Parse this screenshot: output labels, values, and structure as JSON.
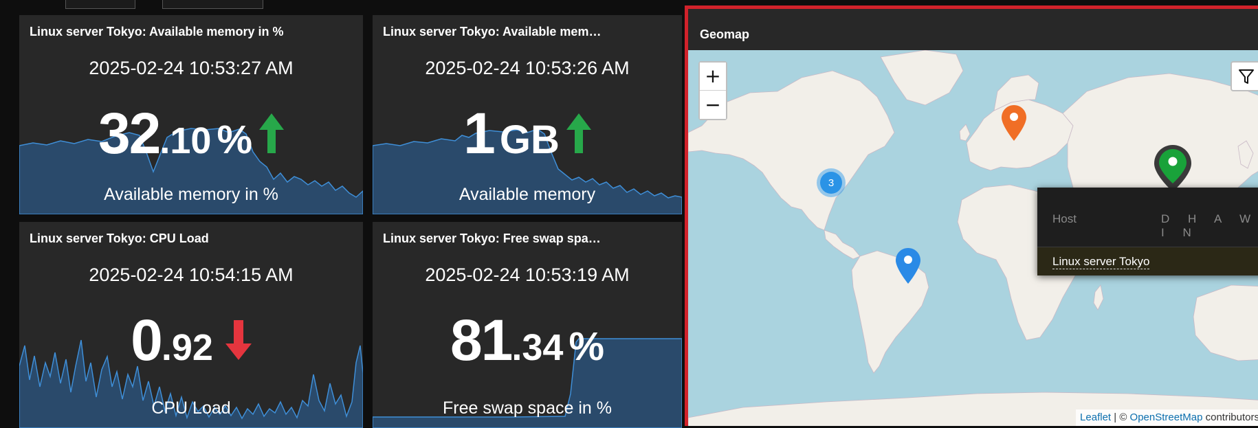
{
  "widgets": [
    {
      "title": "Linux server Tokyo: Available memory in %",
      "timestamp": "2025-02-24 10:53:27 AM",
      "value_int": "32",
      "value_dec": ".10",
      "unit": "%",
      "trend": "up",
      "description": "Available memory in %"
    },
    {
      "title": "Linux server Tokyo: Available mem…",
      "timestamp": "2025-02-24 10:53:26 AM",
      "value_int": "1",
      "value_dec": "",
      "unit": "GB",
      "trend": "up",
      "description": "Available memory"
    },
    {
      "title": "Linux server Tokyo: CPU Load",
      "timestamp": "2025-02-24 10:54:15 AM",
      "value_int": "0",
      "value_dec": ".92",
      "unit": "",
      "trend": "down",
      "description": "CPU Load"
    },
    {
      "title": "Linux server Tokyo: Free swap spa…",
      "timestamp": "2025-02-24 10:53:19 AM",
      "value_int": "81",
      "value_dec": ".34",
      "unit": "%",
      "trend": "",
      "description": "Free swap space in %"
    }
  ],
  "geomap": {
    "title": "Geomap",
    "zoom_in": "+",
    "zoom_out": "−",
    "cluster_count": "3",
    "tooltip": {
      "col_host": "Host",
      "col_severity": "D H A W I N",
      "host": "Linux server Tokyo"
    },
    "attribution": {
      "leaflet": "Leaflet",
      "sep": " | © ",
      "osm": "OpenStreetMap",
      "tail": " contributors"
    }
  },
  "colors": {
    "panel_bg": "#282828",
    "spark_fill": "#2a4a6b",
    "spark_line": "#3f8fd8",
    "trend_up": "#27a84a",
    "trend_down": "#e5353e",
    "selected_border": "#d1222b",
    "water": "#aad3df",
    "land": "#f2efe9"
  }
}
